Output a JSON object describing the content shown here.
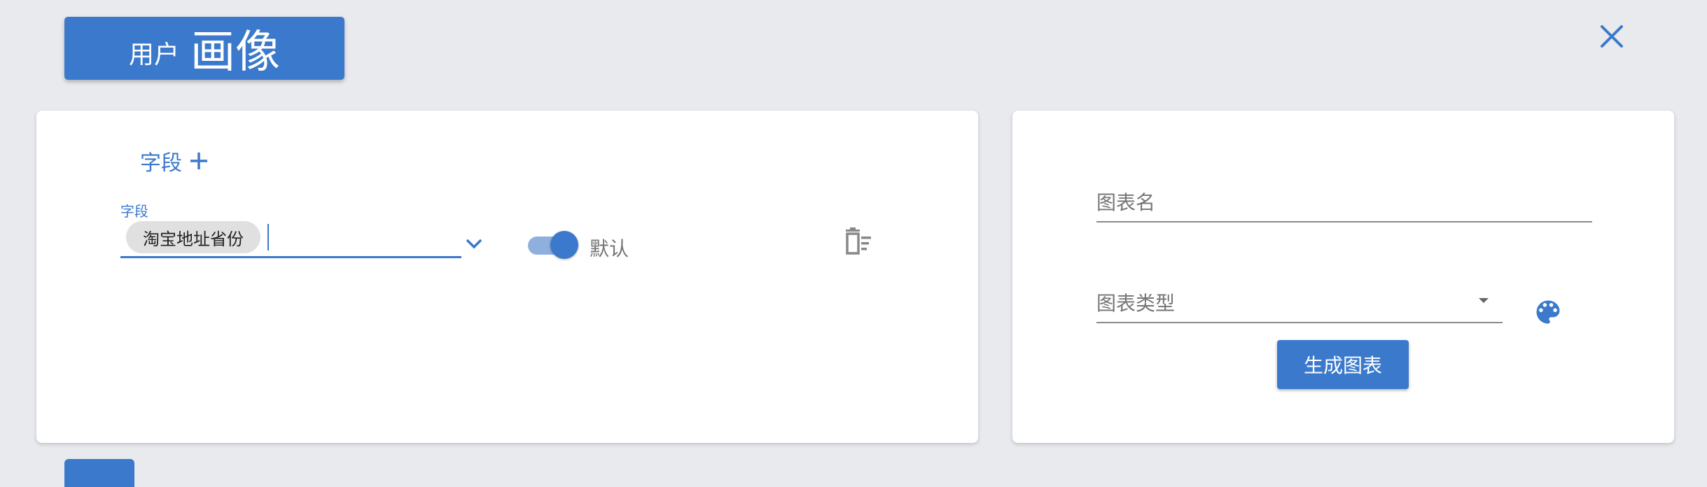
{
  "header": {
    "title_small": "用户",
    "title_big": "画像"
  },
  "icons": {
    "close": "close-icon",
    "add": "plus-icon",
    "chevron": "chevron-down-icon",
    "delete": "delete-list-icon",
    "palette": "palette-icon"
  },
  "colors": {
    "accent": "#3a79cb",
    "background": "#e9eaee"
  },
  "fields_panel": {
    "add_label": "字段",
    "field_label": "字段",
    "selected_chip": "淘宝地址省份",
    "toggle_label": "默认",
    "toggle_on": true
  },
  "chart_panel": {
    "chart_name_placeholder": "图表名",
    "chart_type_placeholder": "图表类型",
    "generate_button": "生成图表"
  }
}
